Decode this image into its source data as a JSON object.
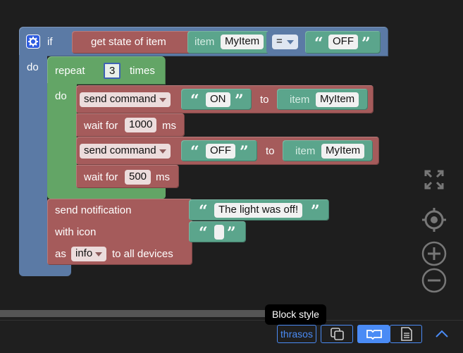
{
  "workspace": {
    "if_block": {
      "if_label": "if",
      "do_label": "do",
      "condition": {
        "get_state_label": "get state of item",
        "item_label": "item",
        "item_value": "MyItem",
        "operator": "=",
        "compare_value": "OFF"
      }
    },
    "repeat_block": {
      "repeat_label": "repeat",
      "count": "3",
      "times_label": "times",
      "do_label": "do",
      "commands": [
        {
          "action": "send command",
          "value": "ON",
          "to_label": "to",
          "item_label": "item",
          "item_value": "MyItem"
        },
        {
          "wait_label": "wait for",
          "ms": "1000",
          "ms_label": "ms"
        },
        {
          "action": "send command",
          "value": "OFF",
          "to_label": "to",
          "item_label": "item",
          "item_value": "MyItem"
        },
        {
          "wait_label": "wait for",
          "ms": "500",
          "ms_label": "ms"
        }
      ]
    },
    "notification_block": {
      "send_label": "send notification",
      "message": "The light was off!",
      "icon_label": "with icon",
      "icon_value": "",
      "as_label": "as",
      "level": "info",
      "devices_label": "to all devices"
    }
  },
  "toolbar": {
    "theme_button": "thrasos",
    "tooltip": "Block style"
  },
  "colors": {
    "logic_blue": "#5b7aa5",
    "loop_green": "#63a566",
    "openhab_red": "#a55b5b",
    "text_teal": "#5ba58c",
    "accent_blue": "#4a8bf5"
  },
  "icons": [
    "gear-icon",
    "fullscreen-icon",
    "center-target-icon",
    "zoom-in-icon",
    "zoom-out-icon",
    "copy-icon",
    "block-mode-icon",
    "code-mode-icon",
    "chevron-up-icon"
  ]
}
